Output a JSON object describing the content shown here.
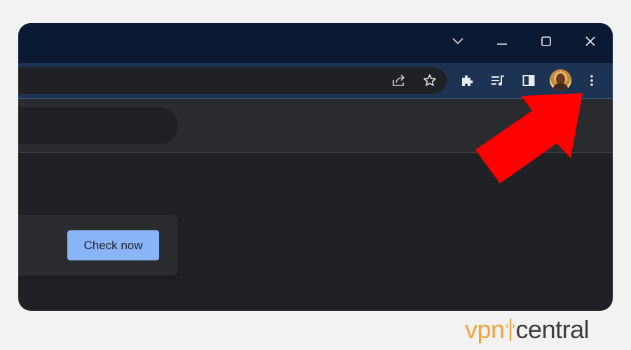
{
  "toolbar": {
    "profile_avatar": "user-avatar",
    "icons": [
      "share-icon",
      "star-icon",
      "extensions-icon",
      "media-icon",
      "side-panel-icon",
      "menu-icon"
    ]
  },
  "main": {
    "card": {
      "button_label": "Check now"
    }
  },
  "annotation": {
    "arrow_color": "#ff0000"
  },
  "branding": {
    "part1": "vpn",
    "part2": "central",
    "color1": "#f2a33a",
    "color2": "#3c3c3c"
  }
}
